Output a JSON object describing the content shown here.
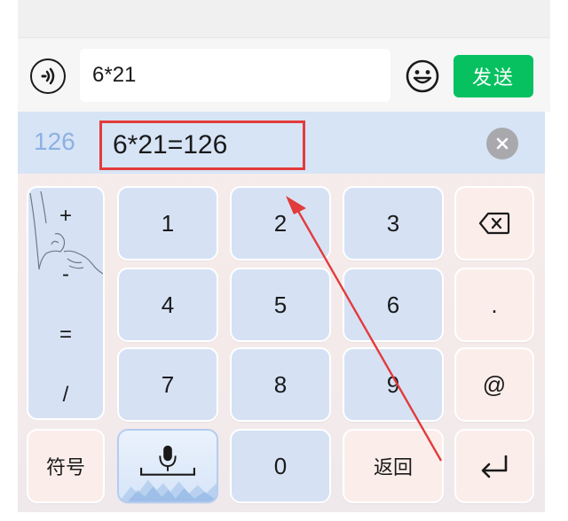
{
  "input_bar": {
    "voice_icon": "voice-waves-icon",
    "input_value": "6*21",
    "emoji_icon": "smiley-icon",
    "send_label": "发送"
  },
  "candidate_bar": {
    "first_candidate": "126",
    "expression": "6*21=126",
    "clear_icon": "clear-x-icon"
  },
  "keypad": {
    "side_ops": [
      "+",
      "-",
      "=",
      "/"
    ],
    "keys": [
      [
        "1",
        "2",
        "3"
      ],
      [
        "4",
        "5",
        "6"
      ],
      [
        "7",
        "8",
        "9"
      ]
    ],
    "backspace_icon": "backspace-icon",
    "dot": ".",
    "at": "@",
    "symbols_label": "符号",
    "mic_icon": "microphone-icon",
    "zero": "0",
    "return_label": "返回",
    "enter_icon": "enter-icon"
  },
  "colors": {
    "send_green": "#07c160",
    "highlight_red": "#e23b3b",
    "key_blue": "#d6e2f4",
    "key_pink": "#fbeeea"
  }
}
